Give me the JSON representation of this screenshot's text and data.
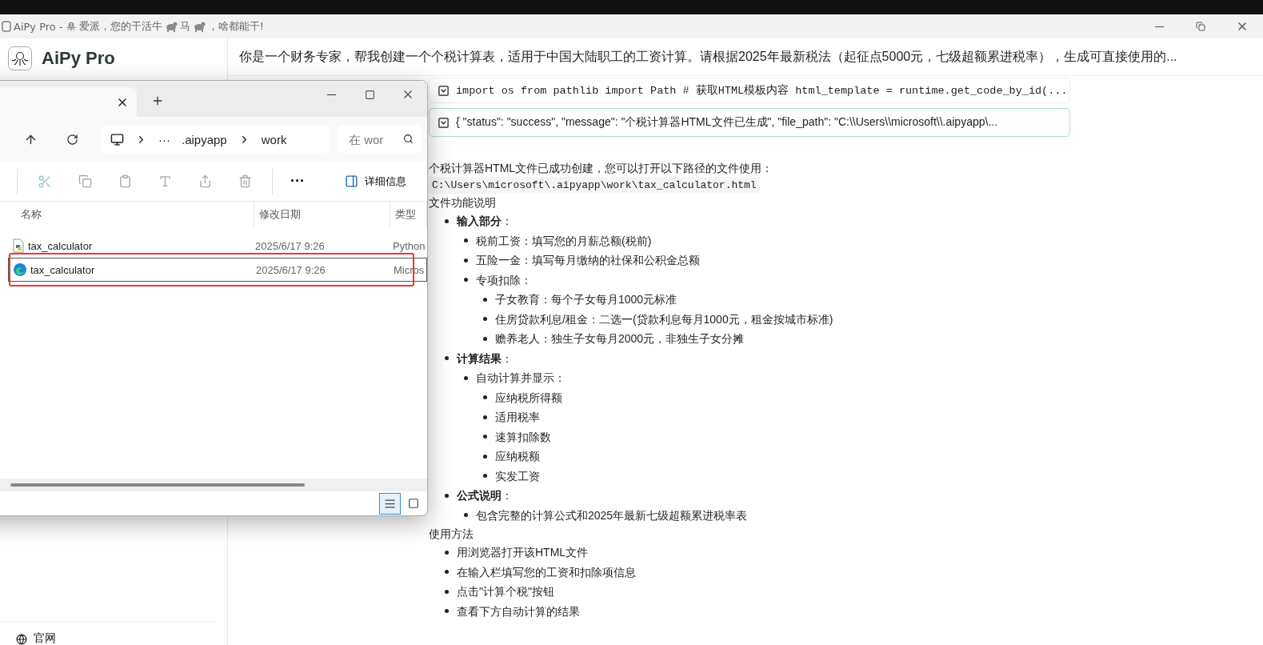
{
  "window": {
    "title_parts": [
      "AiPy Pro -",
      "爱派，您的干活牛",
      "马",
      "，啥都能干!"
    ]
  },
  "sidebar": {
    "app_name": "AiPy Pro",
    "footer_link": "官网"
  },
  "prompt": "你是一个财务专家，帮我创建一个个税计算表，适用于中国大陆职工的工资计算。请根据2025年最新税法（起征点5000元，七级超额累进税率），生成可直接使用的...",
  "code_blocks": [
    {
      "kind": "code",
      "text": "import os from pathlib import Path # 获取HTML模板内容 html_template = runtime.get_code_by_id(..."
    },
    {
      "kind": "result",
      "text": "{ \"status\": \"success\", \"message\": \"个税计算器HTML文件已生成\", \"file_path\": \"C:\\\\Users\\\\microsoft\\\\.aipyapp\\..."
    }
  ],
  "answer": {
    "intro": "个税计算器HTML文件已成功创建，您可以打开以下路径的文件使用：",
    "path": "C:\\Users\\microsoft\\.aipyapp\\work\\tax_calculator.html",
    "sections": [
      {
        "title": "文件功能说明",
        "items": [
          {
            "text": "**输入部分**：",
            "children": [
              {
                "text": "税前工资：填写您的月薪总额(税前)"
              },
              {
                "text": "五险一金：填写每月缴纳的社保和公积金总额"
              },
              {
                "text": "专项扣除：",
                "children": [
                  {
                    "text": "子女教育：每个子女每月1000元标准"
                  },
                  {
                    "text": "住房贷款利息/租金：二选一(贷款利息每月1000元，租金按城市标准)"
                  },
                  {
                    "text": "赡养老人：独生子女每月2000元，非独生子女分摊"
                  }
                ]
              }
            ]
          },
          {
            "text": "**计算结果**：",
            "children": [
              {
                "text": "自动计算并显示：",
                "children": [
                  {
                    "text": "应纳税所得额"
                  },
                  {
                    "text": "适用税率"
                  },
                  {
                    "text": "速算扣除数"
                  },
                  {
                    "text": "应纳税额"
                  },
                  {
                    "text": "实发工资"
                  }
                ]
              }
            ]
          },
          {
            "text": "**公式说明**：",
            "children": [
              {
                "text": "包含完整的计算公式和2025年最新七级超额累进税率表"
              }
            ]
          }
        ]
      },
      {
        "title": "使用方法",
        "items": [
          {
            "text": "用浏览器打开该HTML文件"
          },
          {
            "text": "在输入栏填写您的工资和扣除项信息"
          },
          {
            "text": "点击\"计算个税\"按钮"
          },
          {
            "text": "查看下方自动计算的结果"
          }
        ]
      }
    ]
  },
  "explorer": {
    "address": [
      "···",
      ".aipyapp",
      "work"
    ],
    "search": {
      "placeholder": "在 wor"
    },
    "more": "···",
    "details_button": "详细信息",
    "columns": [
      "名称",
      "修改日期",
      "类型"
    ],
    "rows": [
      {
        "kind": "python",
        "name": "tax_calculator",
        "date": "2025/6/17 9:26",
        "type": "Python",
        "selected": false,
        "highlighted": false
      },
      {
        "kind": "edge",
        "name": "tax_calculator",
        "date": "2025/6/17 9:26",
        "type": "Micros",
        "selected": true,
        "highlighted": true
      }
    ],
    "views": [
      {
        "kind": "details",
        "selected": true
      },
      {
        "kind": "tiles",
        "selected": false
      }
    ]
  }
}
